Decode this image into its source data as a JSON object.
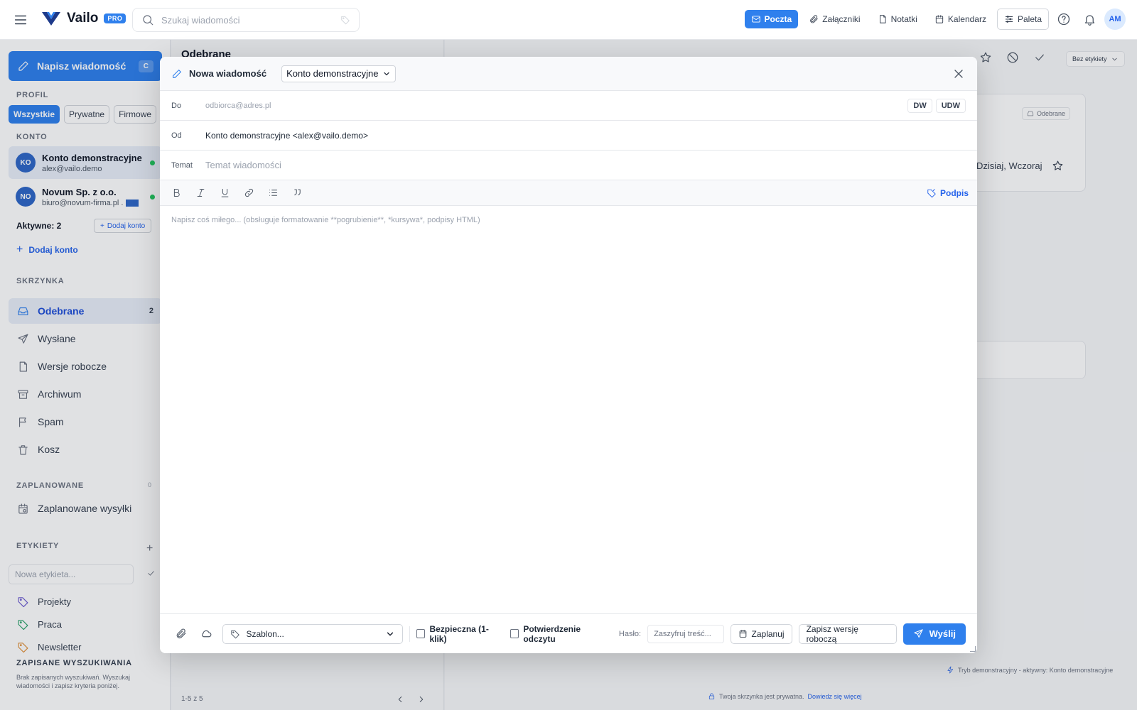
{
  "topbar": {
    "logo": "Vailo",
    "badge": "PRO",
    "search_placeholder": "Szukaj wiadomości",
    "nav": [
      "Poczta",
      "Załączniki",
      "Notatki",
      "Kalendarz"
    ],
    "palette": "Paleta",
    "avatar": "AM",
    "accent": "#2f80ed"
  },
  "sidebar": {
    "compose": "Napisz wiadomość",
    "compose_key": "C",
    "profile_heading": "PROFIL",
    "profiles": [
      "Wszystkie",
      "Prywatne",
      "Firmowe"
    ],
    "account_heading": "KONTO",
    "accounts": [
      {
        "initials": "KO",
        "name": "Konto demonstracyjne",
        "email": "alex@vailo.demo"
      },
      {
        "initials": "NO",
        "name": "Novum Sp. z o.o.",
        "email": "biuro@novum-firma.pl ."
      }
    ],
    "active_label": "Aktywne: 2",
    "add_account_small": "Dodaj konto",
    "add_account": "Dodaj konto",
    "mailbox_heading": "SKRZYNKA",
    "folders": [
      {
        "label": "Odebrane",
        "count": "2"
      },
      {
        "label": "Wysłane",
        "count": ""
      },
      {
        "label": "Wersje robocze",
        "count": ""
      },
      {
        "label": "Archiwum",
        "count": ""
      },
      {
        "label": "Spam",
        "count": ""
      },
      {
        "label": "Kosz",
        "count": ""
      }
    ],
    "scheduled_heading": "ZAPLANOWANE",
    "scheduled_count": "0",
    "scheduled_item": "Zaplanowane wysyłki",
    "labels_heading": "ETYKIETY",
    "new_label_placeholder": "Nowa etykieta...",
    "labels": [
      {
        "name": "Projekty",
        "color": "#6d5bd0"
      },
      {
        "name": "Praca",
        "color": "#2ea36b"
      },
      {
        "name": "Newsletter",
        "color": "#e0903a"
      }
    ],
    "saved_heading": "ZAPISANE WYSZUKIWANIA",
    "saved_text": "Brak zapisanych wyszukiwań. Wyszukaj wiadomości i zapisz kryteria poniżej."
  },
  "list": {
    "title": "Odebrane",
    "pager": "1-5 z 5"
  },
  "reading": {
    "label_filter": "Bez etykiety",
    "tag": "Odebrane",
    "dates": "Dzisiaj, Wczoraj",
    "demo_footer": "Tryb demonstracyjny - aktywny: Konto demonstracyjne",
    "privacy": "Twoja skrzynka jest prywatna.",
    "privacy_link": "Dowiedz się więcej"
  },
  "compose": {
    "title": "Nowa wiadomość",
    "account": "Konto demonstracyjne",
    "to_label": "Do",
    "to_placeholder": "odbiorca@adres.pl",
    "cc": "DW",
    "bcc": "UDW",
    "from_label": "Od",
    "from_value": "Konto demonstracyjne <alex@vailo.demo>",
    "subject_label": "Temat",
    "subject_placeholder": "Temat wiadomości",
    "signature": "Podpis",
    "body_placeholder": "Napisz coś miłego... (obsługuje formatowanie **pogrubienie**, *kursywa*, podpisy HTML)",
    "template": "Szablon...",
    "secure": "Bezpieczna (1-klik)",
    "read_receipt": "Potwierdzenie odczytu",
    "password_label": "Hasło:",
    "password_placeholder": "Zaszyfruj treść...",
    "schedule": "Zaplanuj",
    "save_draft": "Zapisz wersję roboczą",
    "send": "Wyślij"
  }
}
